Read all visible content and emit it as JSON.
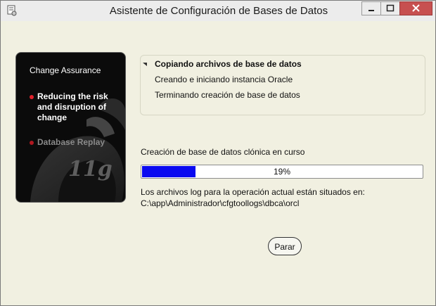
{
  "window": {
    "title": "Asistente de Configuración de Bases de Datos",
    "controls": {
      "minimize_icon": "minimize-icon",
      "maximize_icon": "maximize-icon",
      "close_icon": "close-icon"
    }
  },
  "side_panel": {
    "heading": "Change Assurance",
    "items": [
      {
        "label": "Reducing the risk and disruption of change",
        "active": true
      },
      {
        "label": "Database Replay",
        "active": false
      }
    ],
    "logo_text": "11g"
  },
  "steps": [
    {
      "label": "Copiando archivos de base de datos",
      "current": true
    },
    {
      "label": "Creando e iniciando instancia Oracle",
      "current": false
    },
    {
      "label": "Terminando creación de base de datos",
      "current": false
    }
  ],
  "status": {
    "label": "Creación de base de datos clónica en curso",
    "progress_percent": 19,
    "progress_text": "19%"
  },
  "log": {
    "line1": "Los archivos log para la operación actual están situados en:",
    "line2": "C:\\app\\Administrador\\cfgtoollogs\\dbca\\orcl"
  },
  "buttons": {
    "stop": "Parar"
  },
  "colors": {
    "progress_fill": "#0a0af0",
    "accent_dot": "#e0202a"
  }
}
